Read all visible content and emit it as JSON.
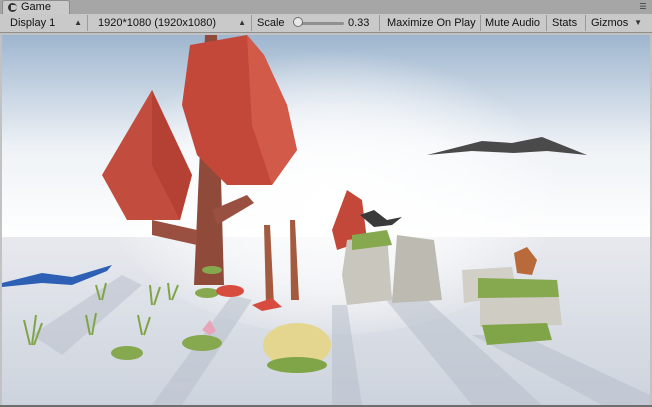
{
  "tab": {
    "label": "Game",
    "icon": "game-controller-icon"
  },
  "toolbar": {
    "display": "Display 1",
    "resolution": "1920*1080 (1920x1080)",
    "scale_label": "Scale",
    "scale_value": "0.33",
    "scale_fraction": 0.08,
    "maximize_on_play": "Maximize On Play",
    "mute_audio": "Mute Audio",
    "stats": "Stats",
    "gizmos": "Gizmos"
  },
  "scene": {
    "sky_top": "#9fb6cf",
    "ground": "#d6dbe3",
    "tree_red": "#c4483a",
    "trunk": "#8f4a3a",
    "grass": "#7fa548",
    "rock": "#c9c6be",
    "blue_bird": "#2d5fb5",
    "eagle": "#4a4a4a"
  }
}
